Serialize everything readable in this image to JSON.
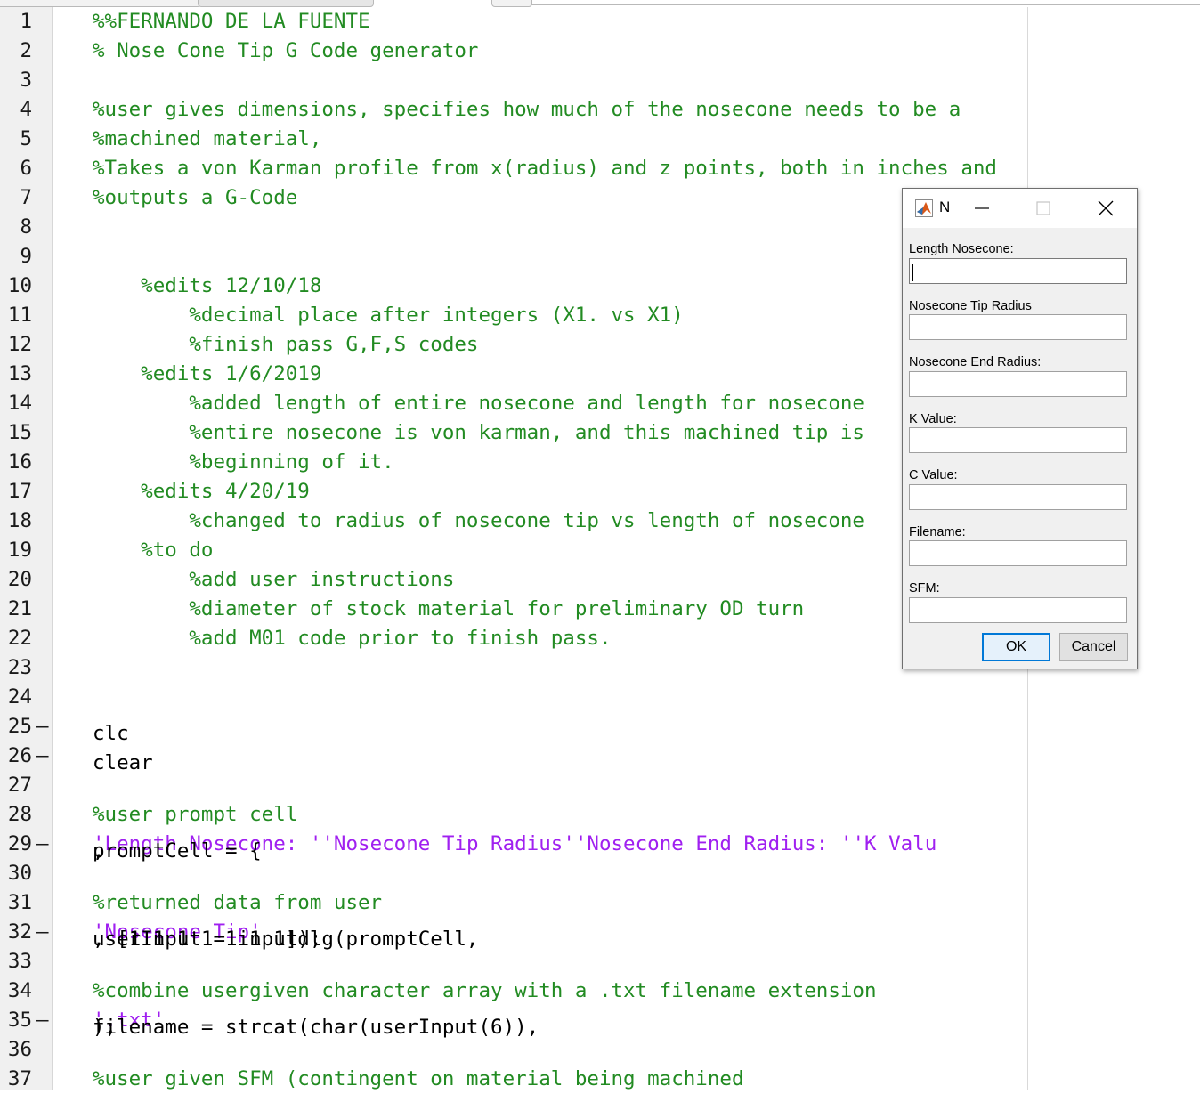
{
  "editor": {
    "lines": [
      {
        "num": "1",
        "marker": "",
        "parts": [
          {
            "text": "%%FERNANDO DE LA FUENTE",
            "cls": "comment"
          }
        ]
      },
      {
        "num": "2",
        "marker": "",
        "parts": [
          {
            "text": "% Nose Cone Tip G Code generator",
            "cls": "comment"
          }
        ]
      },
      {
        "num": "3",
        "marker": "",
        "parts": []
      },
      {
        "num": "4",
        "marker": "",
        "parts": [
          {
            "text": "%user gives dimensions, specifies how much of the nosecone needs to be a",
            "cls": "comment"
          }
        ]
      },
      {
        "num": "5",
        "marker": "",
        "parts": [
          {
            "text": "%machined material,",
            "cls": "comment"
          }
        ]
      },
      {
        "num": "6",
        "marker": "",
        "parts": [
          {
            "text": "%Takes a von Karman profile from x(radius) and z points, both in inches and",
            "cls": "comment"
          }
        ]
      },
      {
        "num": "7",
        "marker": "",
        "parts": [
          {
            "text": "%outputs a G-Code",
            "cls": "comment"
          }
        ]
      },
      {
        "num": "8",
        "marker": "",
        "parts": []
      },
      {
        "num": "9",
        "marker": "",
        "parts": []
      },
      {
        "num": "10",
        "marker": "",
        "parts": [
          {
            "text": "    %edits 12/10/18",
            "cls": "comment"
          }
        ]
      },
      {
        "num": "11",
        "marker": "",
        "parts": [
          {
            "text": "        %decimal place after integers (X1. vs X1)",
            "cls": "comment"
          }
        ]
      },
      {
        "num": "12",
        "marker": "",
        "parts": [
          {
            "text": "        %finish pass G,F,S codes",
            "cls": "comment"
          }
        ]
      },
      {
        "num": "13",
        "marker": "",
        "parts": [
          {
            "text": "    %edits 1/6/2019",
            "cls": "comment"
          }
        ]
      },
      {
        "num": "14",
        "marker": "",
        "parts": [
          {
            "text": "        %added length of entire nosecone and length for nosecone",
            "cls": "comment"
          }
        ]
      },
      {
        "num": "15",
        "marker": "",
        "parts": [
          {
            "text": "        %entire nosecone is von karman, and this machined tip is",
            "cls": "comment"
          }
        ]
      },
      {
        "num": "16",
        "marker": "",
        "parts": [
          {
            "text": "        %beginning of it.",
            "cls": "comment"
          }
        ]
      },
      {
        "num": "17",
        "marker": "",
        "parts": [
          {
            "text": "    %edits 4/20/19",
            "cls": "comment"
          }
        ]
      },
      {
        "num": "18",
        "marker": "",
        "parts": [
          {
            "text": "        %changed to radius of nosecone tip vs length of nosecone",
            "cls": "comment"
          }
        ]
      },
      {
        "num": "19",
        "marker": "",
        "parts": [
          {
            "text": "    %to do",
            "cls": "comment"
          }
        ]
      },
      {
        "num": "20",
        "marker": "",
        "parts": [
          {
            "text": "        %add user instructions",
            "cls": "comment"
          }
        ]
      },
      {
        "num": "21",
        "marker": "",
        "parts": [
          {
            "text": "        %diameter of stock material for preliminary OD turn",
            "cls": "comment"
          }
        ]
      },
      {
        "num": "22",
        "marker": "",
        "parts": [
          {
            "text": "        %add M01 code prior to finish pass.",
            "cls": "comment"
          }
        ]
      },
      {
        "num": "23",
        "marker": "",
        "parts": []
      },
      {
        "num": "24",
        "marker": "",
        "parts": []
      },
      {
        "num": "25",
        "marker": "–",
        "parts": [
          {
            "text": "clc",
            "cls": "code"
          }
        ]
      },
      {
        "num": "26",
        "marker": "–",
        "parts": [
          {
            "text": "clear",
            "cls": "code"
          }
        ]
      },
      {
        "num": "27",
        "marker": "",
        "parts": []
      },
      {
        "num": "28",
        "marker": "",
        "parts": [
          {
            "text": "%user prompt cell",
            "cls": "comment"
          }
        ]
      },
      {
        "num": "29",
        "marker": "–",
        "parts": [
          {
            "text": "promptCell = {",
            "cls": "code"
          },
          {
            "text": "'Length Nosecone: '",
            "cls": "str"
          },
          {
            "text": ",",
            "cls": "code"
          },
          {
            "text": "'Nosecone Tip Radius'",
            "cls": "str"
          },
          {
            "text": ", ",
            "cls": "code"
          },
          {
            "text": "'Nosecone End Radius: '",
            "cls": "str"
          },
          {
            "text": ", ",
            "cls": "code"
          },
          {
            "text": "'K Valu",
            "cls": "str"
          }
        ]
      },
      {
        "num": "30",
        "marker": "",
        "parts": []
      },
      {
        "num": "31",
        "marker": "",
        "parts": [
          {
            "text": "%returned data from user",
            "cls": "comment"
          }
        ]
      },
      {
        "num": "32",
        "marker": "–",
        "parts": [
          {
            "text": "userInput = inputdlg(promptCell, ",
            "cls": "code"
          },
          {
            "text": "'Nosecone Tip'",
            "cls": "str"
          },
          {
            "text": ", [1 1 1 1 1 1 1]);",
            "cls": "code"
          }
        ]
      },
      {
        "num": "33",
        "marker": "",
        "parts": []
      },
      {
        "num": "34",
        "marker": "",
        "parts": [
          {
            "text": "%combine usergiven character array with a .txt filename extension",
            "cls": "comment"
          }
        ]
      },
      {
        "num": "35",
        "marker": "–",
        "parts": [
          {
            "text": "filename = strcat(char(userInput(6)),",
            "cls": "code"
          },
          {
            "text": "'.txt'",
            "cls": "str"
          },
          {
            "text": ");",
            "cls": "code"
          }
        ]
      },
      {
        "num": "36",
        "marker": "",
        "parts": []
      },
      {
        "num": "37",
        "marker": "",
        "parts": [
          {
            "text": "%user given SFM (contingent on material being machined",
            "cls": "comment"
          }
        ]
      }
    ]
  },
  "dialog": {
    "title": "Nosecone Tip",
    "app_icon": "matlab-icon",
    "fields": [
      {
        "label": "Length Nosecone:",
        "value": ""
      },
      {
        "label": "Nosecone Tip Radius",
        "value": ""
      },
      {
        "label": "Nosecone End Radius:",
        "value": ""
      },
      {
        "label": "K Value:",
        "value": ""
      },
      {
        "label": "C Value:",
        "value": ""
      },
      {
        "label": "Filename:",
        "value": ""
      },
      {
        "label": "SFM:",
        "value": ""
      }
    ],
    "ok_label": "OK",
    "cancel_label": "Cancel"
  },
  "colors": {
    "comment": "#228b22",
    "string": "#a020f0",
    "code": "#000000",
    "focus_accent": "#0078d7"
  }
}
